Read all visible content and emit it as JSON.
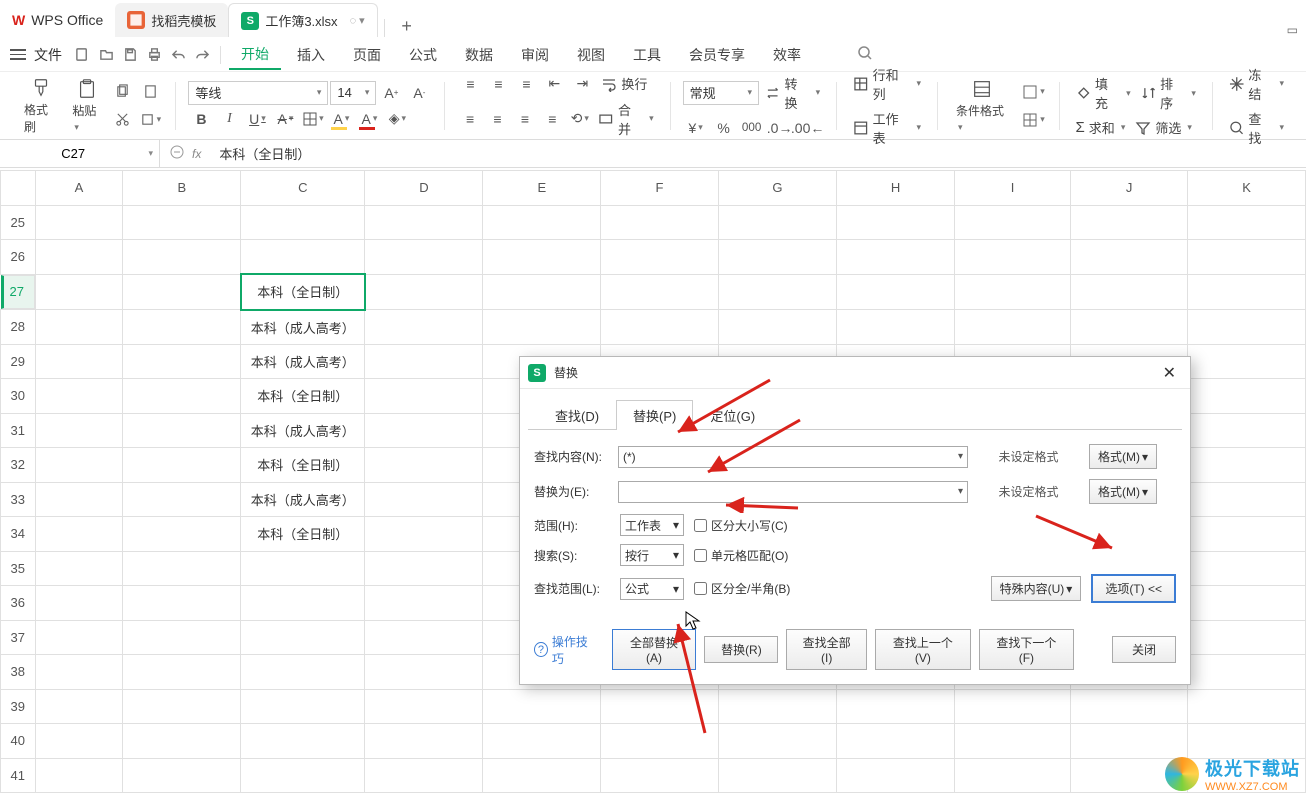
{
  "titlebar": {
    "app": "WPS Office",
    "tab2": "找稻壳模板",
    "tab3": "工作簿3.xlsx",
    "tab3_sub": "◌ ▾",
    "plus": "+"
  },
  "menu": {
    "file": "文件",
    "items": [
      "开始",
      "插入",
      "页面",
      "公式",
      "数据",
      "审阅",
      "视图",
      "工具",
      "会员专享",
      "效率"
    ],
    "active": 0
  },
  "ribbon": {
    "format_painter": "格式刷",
    "paste": "粘贴",
    "font_name": "等线",
    "font_size": "14",
    "wrap": "换行",
    "merge": "合并",
    "numfmt": "常规",
    "convert": "转换",
    "rowcol": "行和列",
    "worksheet": "工作表",
    "cond": "条件格式",
    "fill": "填充",
    "sort": "排序",
    "sum": "求和",
    "filter": "筛选",
    "freeze": "冻结",
    "find": "查找"
  },
  "formula_bar": {
    "cell": "C27",
    "value": "本科（全日制）"
  },
  "cols": [
    "A",
    "B",
    "C",
    "D",
    "E",
    "F",
    "G",
    "H",
    "I",
    "J",
    "K"
  ],
  "rows": [
    {
      "n": "25"
    },
    {
      "n": "26"
    },
    {
      "n": "27",
      "sel": true,
      "c": "本科（全日制）"
    },
    {
      "n": "28",
      "c": "本科（成人高考）"
    },
    {
      "n": "29",
      "c": "本科（成人高考）"
    },
    {
      "n": "30",
      "c": "本科（全日制）"
    },
    {
      "n": "31",
      "c": "本科（成人高考）"
    },
    {
      "n": "32",
      "c": "本科（全日制）"
    },
    {
      "n": "33",
      "c": "本科（成人高考）"
    },
    {
      "n": "34",
      "c": "本科（全日制）"
    },
    {
      "n": "35"
    },
    {
      "n": "36"
    },
    {
      "n": "37"
    },
    {
      "n": "38"
    },
    {
      "n": "39"
    },
    {
      "n": "40"
    },
    {
      "n": "41"
    }
  ],
  "dialog": {
    "title": "替换",
    "tabs": [
      "查找(D)",
      "替换(P)",
      "定位(G)"
    ],
    "active_tab": 1,
    "find_label": "查找内容(N):",
    "find_value": "(*)",
    "replace_label": "替换为(E):",
    "replace_value": "",
    "no_format": "未设定格式",
    "format_btn": "格式(M)",
    "scope_label": "范围(H):",
    "scope_value": "工作表",
    "case_label": "区分大小写(C)",
    "search_label": "搜索(S):",
    "search_value": "按行",
    "cellmatch_label": "单元格匹配(O)",
    "lookin_label": "查找范围(L):",
    "lookin_value": "公式",
    "fullhalf_label": "区分全/半角(B)",
    "special": "特殊内容(U)",
    "options": "选项(T) <<",
    "tips": "操作技巧",
    "replace_all": "全部替换(A)",
    "replace_one": "替换(R)",
    "find_all": "查找全部(I)",
    "find_prev": "查找上一个(V)",
    "find_next": "查找下一个(F)",
    "close": "关闭"
  },
  "watermark": {
    "line1": "极光下载站",
    "line2": "WWW.XZ7.COM"
  }
}
